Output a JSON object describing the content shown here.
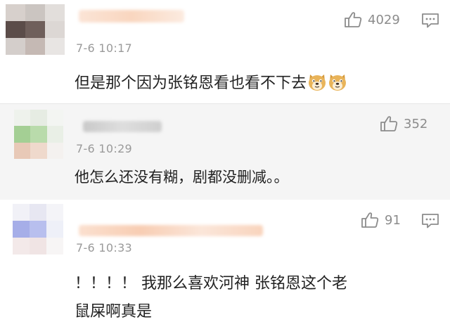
{
  "comments": [
    {
      "timestamp": "7-6 10:17",
      "likes": "4029",
      "text": "但是那个因为张铭恩看也看不下去",
      "emojis": [
        "doge-emoji",
        "doge-emoji"
      ]
    },
    {
      "timestamp": "7-6 10:29",
      "likes": "352",
      "text": "他怎么还没有糊，剧都没删减。。"
    },
    {
      "timestamp": "7-6 10:33",
      "likes": "91",
      "text_line1": "！！！！ 我那么喜欢河神 张铭恩这个老",
      "text_line2": "鼠屎啊真是"
    }
  ],
  "icons": {
    "like": "thumbs-up-icon",
    "reply": "comment-bubble-icon",
    "emoji": "doge-emoji"
  },
  "colors": {
    "background": "#ffffff",
    "highlighted_background": "#f5f5f5",
    "text": "#222222",
    "meta": "#9a9a9a",
    "icon": "#8c8c8c"
  }
}
